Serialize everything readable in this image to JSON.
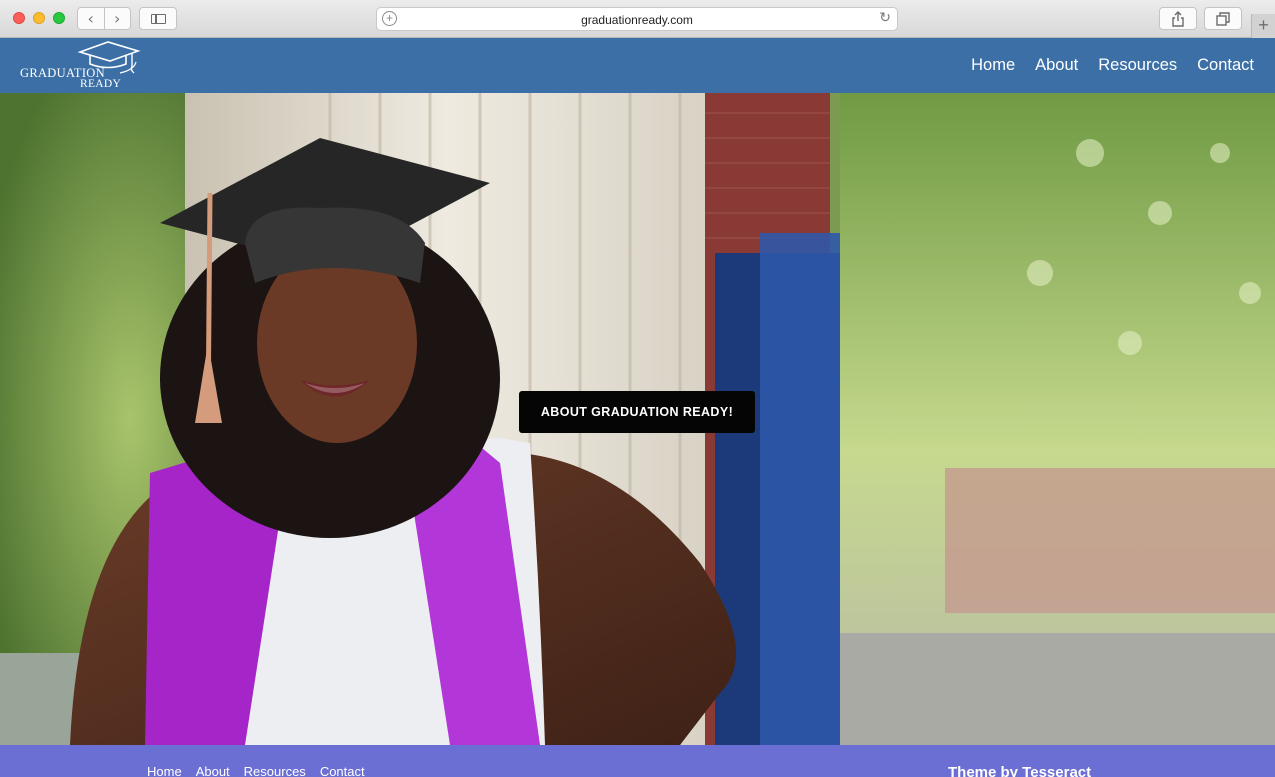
{
  "browser": {
    "url": "graduationready.com",
    "back_icon": "‹",
    "forward_icon": "›",
    "reload_icon": "↻",
    "new_tab_icon": "+"
  },
  "site": {
    "logo_line1": "GRADUATION",
    "logo_line2": "READY",
    "nav": [
      "Home",
      "About",
      "Resources",
      "Contact"
    ]
  },
  "hero": {
    "button_label": "ABOUT GRADUATION READY!"
  },
  "footer": {
    "nav": [
      "Home",
      "About",
      "Resources",
      "Contact"
    ],
    "credit": "Theme by Tesseract"
  },
  "colors": {
    "header_bg": "#3b6fa6",
    "footer_bg": "#6b6fd4",
    "cta_bg": "#050505"
  }
}
